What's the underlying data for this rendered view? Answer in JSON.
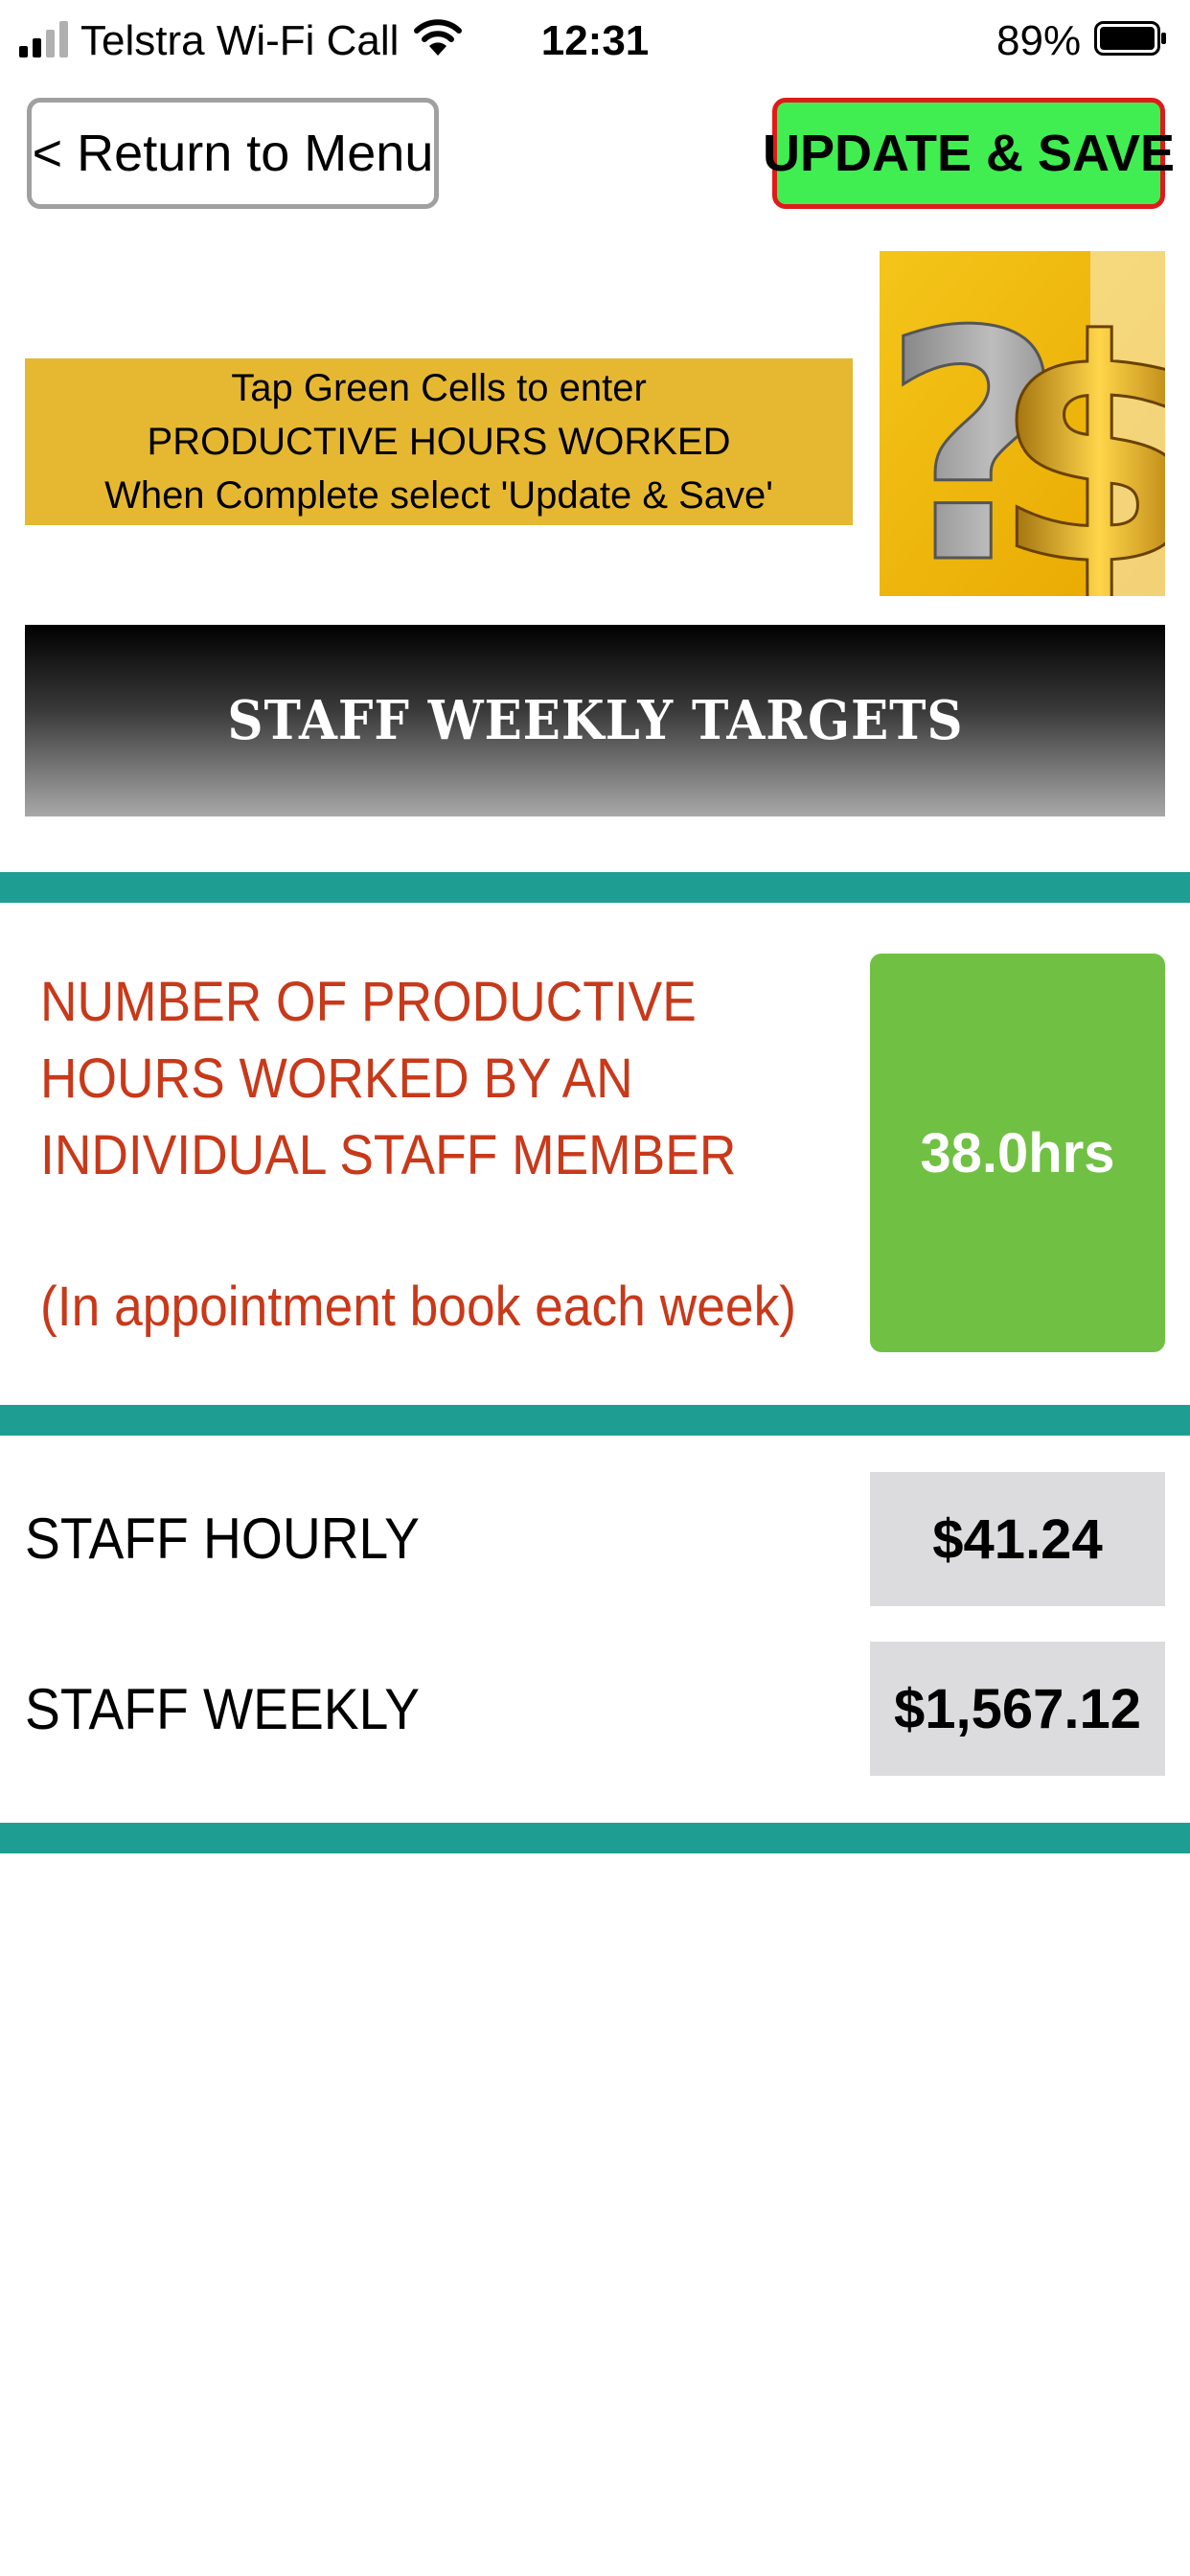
{
  "status_bar": {
    "carrier": "Telstra Wi-Fi Call",
    "time": "12:31",
    "battery_percent": "89%",
    "battery_level": 0.89,
    "icons": [
      "signal-icon",
      "wifi-icon",
      "battery-icon"
    ]
  },
  "header": {
    "return_label": "< Return to Menu",
    "update_label": "UPDATE & SAVE"
  },
  "instructions": {
    "line1": "Tap Green Cells to enter",
    "line2": "PRODUCTIVE HOURS WORKED",
    "line3": "When Complete select 'Update & Save'"
  },
  "logo": {
    "icon": "question-dollar-logo"
  },
  "banner": {
    "title": "STAFF WEEKLY TARGETS"
  },
  "productive_hours": {
    "line1": "NUMBER OF PRODUCTIVE",
    "line2": "HOURS WORKED BY AN",
    "line3": "INDIVIDUAL STAFF MEMBER",
    "note": "(In appointment book each week)",
    "value": "38.0hrs"
  },
  "staff_rows": [
    {
      "label": "STAFF HOURLY",
      "value": "$41.24"
    },
    {
      "label": "STAFF WEEKLY",
      "value": "$1,567.12"
    }
  ],
  "colors": {
    "accent_teal": "#1e9e92",
    "input_green": "#70c044",
    "save_green": "#40ee52",
    "save_border_red": "#e01a1a",
    "instruction_gold": "#e6b832",
    "label_red": "#c8391a",
    "value_grey": "#dcdcde"
  }
}
